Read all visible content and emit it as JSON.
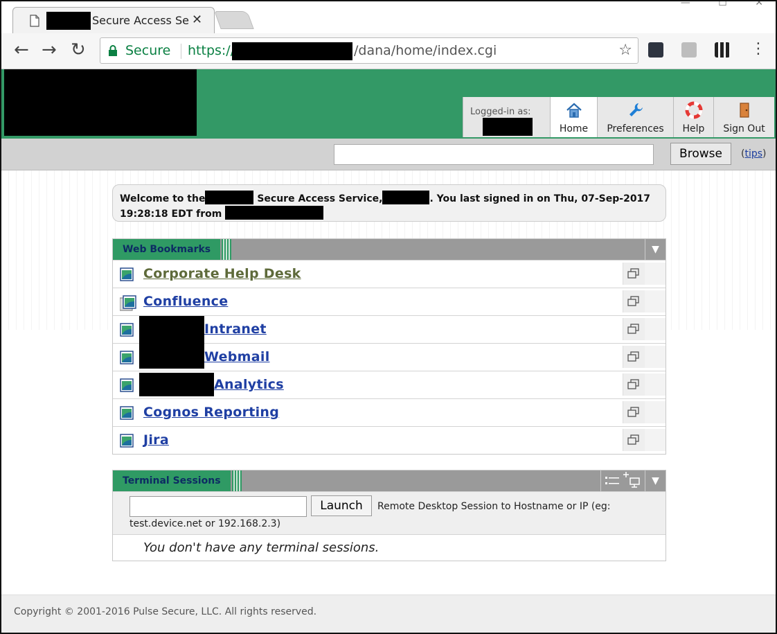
{
  "browser": {
    "tab_title": "Secure Access Se",
    "secure_label": "Secure",
    "url_scheme": "https://",
    "url_path": "/dana/home/index.cgi"
  },
  "header": {
    "logged_in_label": "Logged-in as:",
    "nav": [
      {
        "label": "Home",
        "icon": "home-icon"
      },
      {
        "label": "Preferences",
        "icon": "wrench-icon"
      },
      {
        "label": "Help",
        "icon": "lifebuoy-icon"
      },
      {
        "label": "Sign Out",
        "icon": "door-icon"
      }
    ]
  },
  "search": {
    "value": "",
    "browse_label": "Browse",
    "tips_open": "(",
    "tips_label": "tips",
    "tips_close": ")"
  },
  "welcome": {
    "part1": "Welcome to the",
    "part2": " Secure Access Service,",
    "part3": ".  You last signed in on  Thu, 07-Sep-2017 19:28:18 EDT   from "
  },
  "bookmarks": {
    "title": "Web Bookmarks",
    "items": [
      {
        "label": "Corporate Help Desk "
      },
      {
        "label": "Confluence "
      },
      {
        "label": "Intranet "
      },
      {
        "label": "Webmail "
      },
      {
        "label": " Analytics "
      },
      {
        "label": "Cognos Reporting "
      },
      {
        "label": "Jira "
      }
    ]
  },
  "terminal": {
    "title": "Terminal Sessions",
    "host_value": "",
    "launch_label": "Launch",
    "desc_line1": "Remote Desktop Session to Hostname or IP (eg:",
    "desc_line2": "test.device.net or 192.168.2.3)",
    "empty_text": "You don't have any terminal sessions."
  },
  "footer": {
    "copyright": "Copyright © 2001-2016 Pulse Secure, LLC. All rights reserved."
  },
  "colors": {
    "brand_green": "#339966",
    "link_blue": "#1f3fa3",
    "visited_link": "#5e6a3a"
  }
}
